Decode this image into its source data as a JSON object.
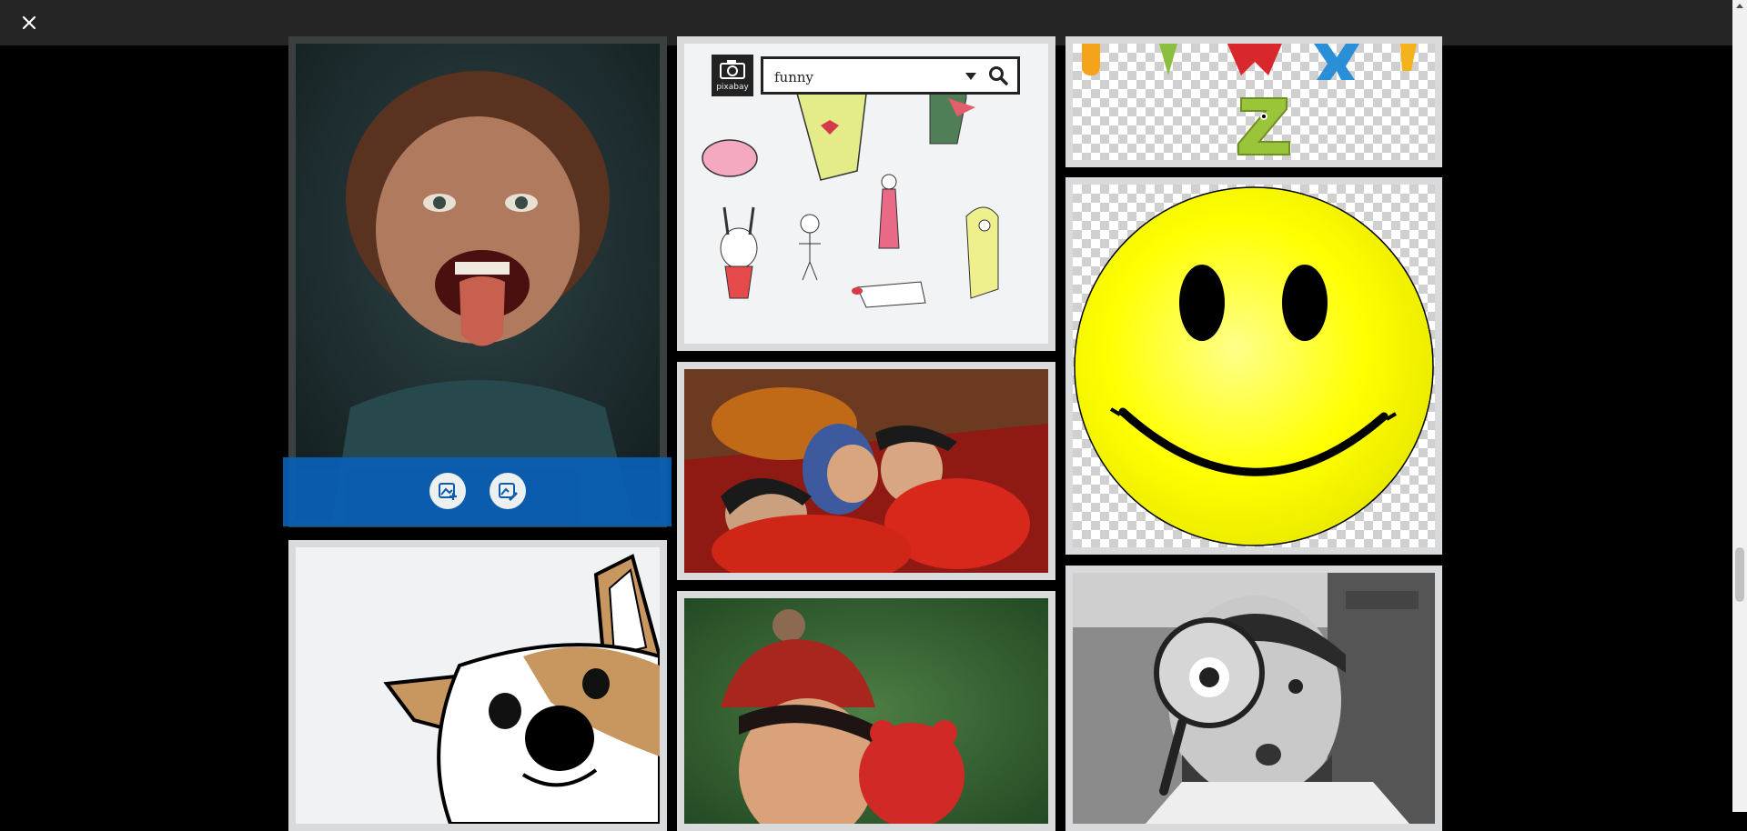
{
  "search": {
    "value": "funny",
    "logo_label": "pixabay"
  },
  "icons": {
    "close": "close-icon",
    "search": "search-icon",
    "dropdown": "caret-down-icon",
    "camera": "camera-icon",
    "add_image": "image-add-icon",
    "edit_image": "image-edit-icon"
  },
  "colors": {
    "topbar": "#252525",
    "accent_blue": "#0a5fb6",
    "smiley_yellow": "#ffff00"
  },
  "letters": [
    "U",
    "V",
    "W",
    "X",
    "Y",
    "Z"
  ]
}
